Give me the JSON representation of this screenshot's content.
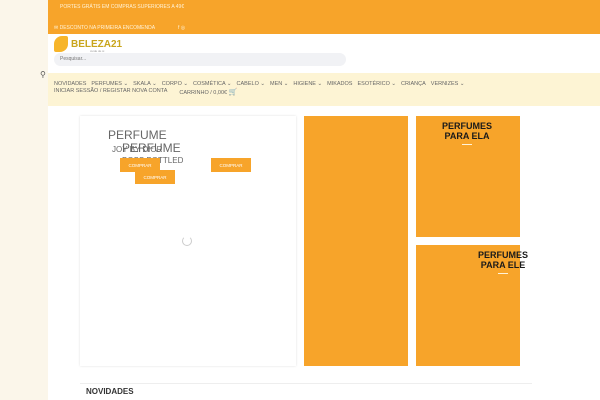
{
  "topbar": {
    "shipping": "PORTES GRÁTIS EM COMPRAS SUPERIORES A 49€",
    "discount": "DESCONTO NA PRIMEIRA ENCOMENDA",
    "social": "f ◎"
  },
  "logo": {
    "name": "BELEZA21",
    "tagline": "cuide de si"
  },
  "search": {
    "placeholder": "Pesquisar..."
  },
  "nav": {
    "items": [
      "NOVIDADES",
      "PERFUMES ⌄",
      "SKALA ⌄",
      "CORPO ⌄",
      "COSMÉTICA ⌄",
      "CABELO ⌄",
      "MEN ⌄",
      "HIGIENE ⌄",
      "MIKADOS",
      "ESOTÉRICO ⌄",
      "CRIANÇA",
      "VERNIZES ⌄"
    ],
    "login": "INICIAR SESSÃO / REGISTAR NOVA CONTA",
    "cart": "CARRINHO / 0,00€"
  },
  "slider": {
    "title1": "PERFUME",
    "sub1": "JOY BY DIOR",
    "title2": "PERFUME",
    "sub2": "BOSS BOTTLED",
    "buy": "COMPRAR"
  },
  "tiles": {
    "ela": "PERFUMES PARA ELA",
    "ele": "PERFUMES PARA ELE"
  },
  "section": {
    "title": "NOVIDADES"
  }
}
